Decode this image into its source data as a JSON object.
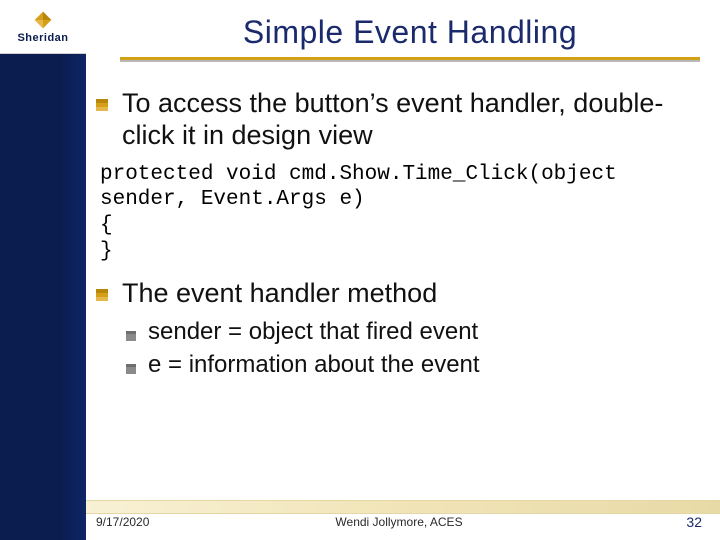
{
  "brand": {
    "name": "Sheridan"
  },
  "title": "Simple Event Handling",
  "bullets": {
    "b1": "To access the button’s event handler, double-click it in design view",
    "b2": "The event handler method",
    "sub1": "sender = object that fired event",
    "sub2": "e = information about the event"
  },
  "code": "protected void cmd.Show.Time_Click(object sender, Event.Args e)\n{\n}",
  "footer": {
    "date": "9/17/2020",
    "author": "Wendi Jollymore, ACES",
    "page": "32"
  }
}
